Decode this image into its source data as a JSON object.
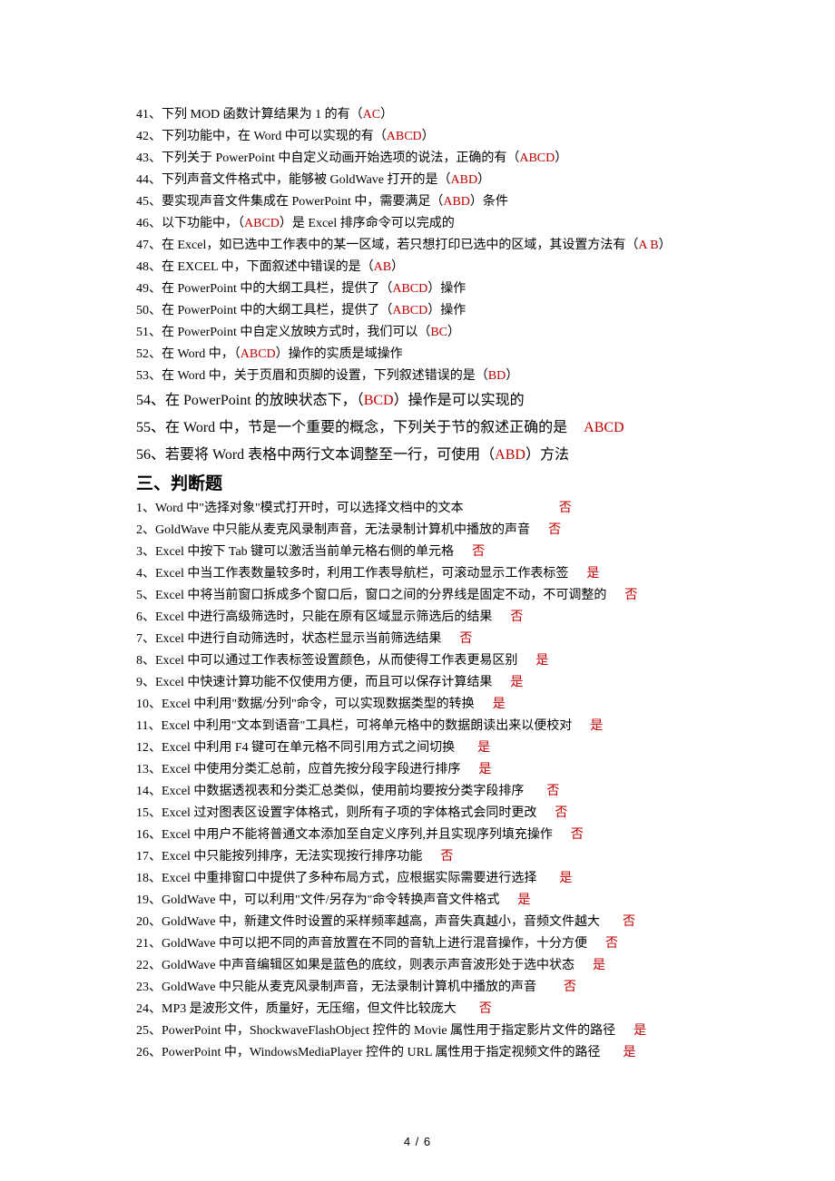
{
  "multi_choice": [
    {
      "num": "41",
      "text": "下列 MOD 函数计算结果为 1 的有（",
      "ans": "AC",
      "tail": "）"
    },
    {
      "num": "42",
      "text": "下列功能中，在 Word 中可以实现的有（",
      "ans": "ABCD",
      "tail": "）"
    },
    {
      "num": "43",
      "text": "下列关于 PowerPoint 中自定义动画开始选项的说法，正确的有（",
      "ans": "ABCD",
      "tail": "）"
    },
    {
      "num": "44",
      "text": "下列声音文件格式中，能够被 GoldWave 打开的是（",
      "ans": "ABD",
      "tail": "）"
    },
    {
      "num": "45",
      "text": "要实现声音文件集成在 PowerPoint 中，需要满足（",
      "ans": "ABD",
      "tail": "）条件"
    },
    {
      "num": "46",
      "text": "以下功能中，（",
      "ans": "ABCD",
      "tail": "）是 Excel 排序命令可以完成的"
    },
    {
      "num": "47",
      "text": "在 Excel，如已选中工作表中的某一区域，若只想打印已选中的区域，其设置方法有（",
      "ans": "A B",
      "tail": "）"
    },
    {
      "num": "48",
      "text": "在 EXCEL 中，下面叙述中错误的是（",
      "ans": "AB",
      "tail": "）"
    },
    {
      "num": "49",
      "text": "在 PowerPoint 中的大纲工具栏，提供了（",
      "ans": "ABCD",
      "tail": "）操作"
    },
    {
      "num": "50",
      "text": "在 PowerPoint 中的大纲工具栏，提供了（",
      "ans": "ABCD",
      "tail": "）操作"
    },
    {
      "num": "51",
      "text": "在 PowerPoint 中自定义放映方式时，我们可以（",
      "ans": "BC",
      "tail": "）"
    },
    {
      "num": "52",
      "text": "在 Word 中，（",
      "ans": "ABCD",
      "tail": "）操作的实质是域操作"
    },
    {
      "num": "53",
      "text": "在 Word 中，关于页眉和页脚的设置，下列叙述错误的是（",
      "ans": "BD",
      "tail": "）"
    }
  ],
  "multi_choice_big": [
    {
      "num": "54",
      "text": "在 PowerPoint 的放映状态下，（",
      "ans": "BCD",
      "tail": "）操作是可以实现的"
    },
    {
      "num": "55",
      "text": "在 Word 中，节是一个重要的概念，下列关于节的叙述正确的是",
      "gap": 18,
      "ans": "ABCD",
      "tail": ""
    },
    {
      "num": "56",
      "text": "若要将 Word 表格中两行文本调整至一行，可使用（",
      "ans": "ABD",
      "tail": "）方法"
    }
  ],
  "section3_title": "三、判断题",
  "true_false": [
    {
      "num": "1",
      "text": "Word 中\"选择对象\"模式打开时，可以选择文档中的文本",
      "gap": 105,
      "ans": "否"
    },
    {
      "num": "2",
      "text": "GoldWave 中只能从麦克风录制声音，无法录制计算机中播放的声音",
      "gap": 20,
      "ans": "否"
    },
    {
      "num": "3",
      "text": "Excel 中按下 Tab 键可以激活当前单元格右侧的单元格",
      "gap": 20,
      "ans": "否"
    },
    {
      "num": "4",
      "text": "Excel 中当工作表数量较多时，利用工作表导航栏，可滚动显示工作表标签",
      "gap": 20,
      "ans": "是"
    },
    {
      "num": "5",
      "text": "Excel 中将当前窗口拆成多个窗口后，窗口之间的分界线是固定不动，不可调整的",
      "gap": 20,
      "ans": "否"
    },
    {
      "num": "6",
      "text": "Excel 中进行高级筛选时，只能在原有区域显示筛选后的结果",
      "gap": 20,
      "ans": "否"
    },
    {
      "num": "7",
      "text": "Excel 中进行自动筛选时，状态栏显示当前筛选结果",
      "gap": 20,
      "ans": "否"
    },
    {
      "num": "8",
      "text": "Excel 中可以通过工作表标签设置颜色，从而使得工作表更易区别",
      "gap": 20,
      "ans": "是"
    },
    {
      "num": "9",
      "text": "Excel 中快速计算功能不仅使用方便，而且可以保存计算结果",
      "gap": 20,
      "ans": "是"
    },
    {
      "num": "10",
      "text": "Excel 中利用\"数据/分列\"命令，可以实现数据类型的转换",
      "gap": 20,
      "ans": "是"
    },
    {
      "num": "11",
      "text": "Excel 中利用\"文本到语音\"工具栏，可将单元格中的数据朗读出来以便校对",
      "gap": 20,
      "ans": "是"
    },
    {
      "num": "12",
      "text": "Excel 中利用 F4 键可在单元格不同引用方式之间切换",
      "gap": 25,
      "ans": "是"
    },
    {
      "num": "13",
      "text": "Excel 中使用分类汇总前，应首先按分段字段进行排序",
      "gap": 20,
      "ans": "是"
    },
    {
      "num": "14",
      "text": "Excel 中数据透视表和分类汇总类似，使用前均要按分类字段排序",
      "gap": 25,
      "ans": "否"
    },
    {
      "num": "15",
      "text": "Excel 过对图表区设置字体格式，则所有子项的字体格式会同时更改",
      "gap": 20,
      "ans": "否"
    },
    {
      "num": "16",
      "text": "Excel 中用户不能将普通文本添加至自定义序列,并且实现序列填充操作",
      "gap": 20,
      "ans": "否"
    },
    {
      "num": "17",
      "text": "Excel 中只能按列排序，无法实现按行排序功能",
      "gap": 20,
      "ans": "否"
    },
    {
      "num": "18",
      "text": "Excel 中重排窗口中提供了多种布局方式，应根据实际需要进行选择",
      "gap": 25,
      "ans": "是"
    },
    {
      "num": "19",
      "text": "GoldWave 中，可以利用\"文件/另存为\"命令转换声音文件格式",
      "gap": 20,
      "ans": "是"
    },
    {
      "num": "20",
      "text": "GoldWave 中，新建文件时设置的采样频率越高，声音失真越小，音频文件越大",
      "gap": 25,
      "ans": "否"
    },
    {
      "num": "21",
      "text": "GoldWave 中可以把不同的声音放置在不同的音轨上进行混音操作，十分方便",
      "gap": 20,
      "ans": "否"
    },
    {
      "num": "22",
      "text": "GoldWave 中声音编辑区如果是蓝色的底纹，则表示声音波形处于选中状态",
      "gap": 20,
      "ans": "是"
    },
    {
      "num": "23",
      "text": "GoldWave 中只能从麦克风录制声音，无法录制计算机中播放的声音",
      "gap": 30,
      "ans": "否"
    },
    {
      "num": "24",
      "text": "MP3 是波形文件，质量好，无压缩，但文件比较庞大",
      "gap": 25,
      "ans": "否"
    },
    {
      "num": "25",
      "text": "PowerPoint 中，ShockwaveFlashObject 控件的 Movie 属性用于指定影片文件的路径",
      "gap": 20,
      "ans": "是"
    },
    {
      "num": "26",
      "text": "PowerPoint 中，WindowsMediaPlayer 控件的 URL 属性用于指定视频文件的路径",
      "gap": 25,
      "ans": "是"
    }
  ],
  "footer": "4 / 6"
}
